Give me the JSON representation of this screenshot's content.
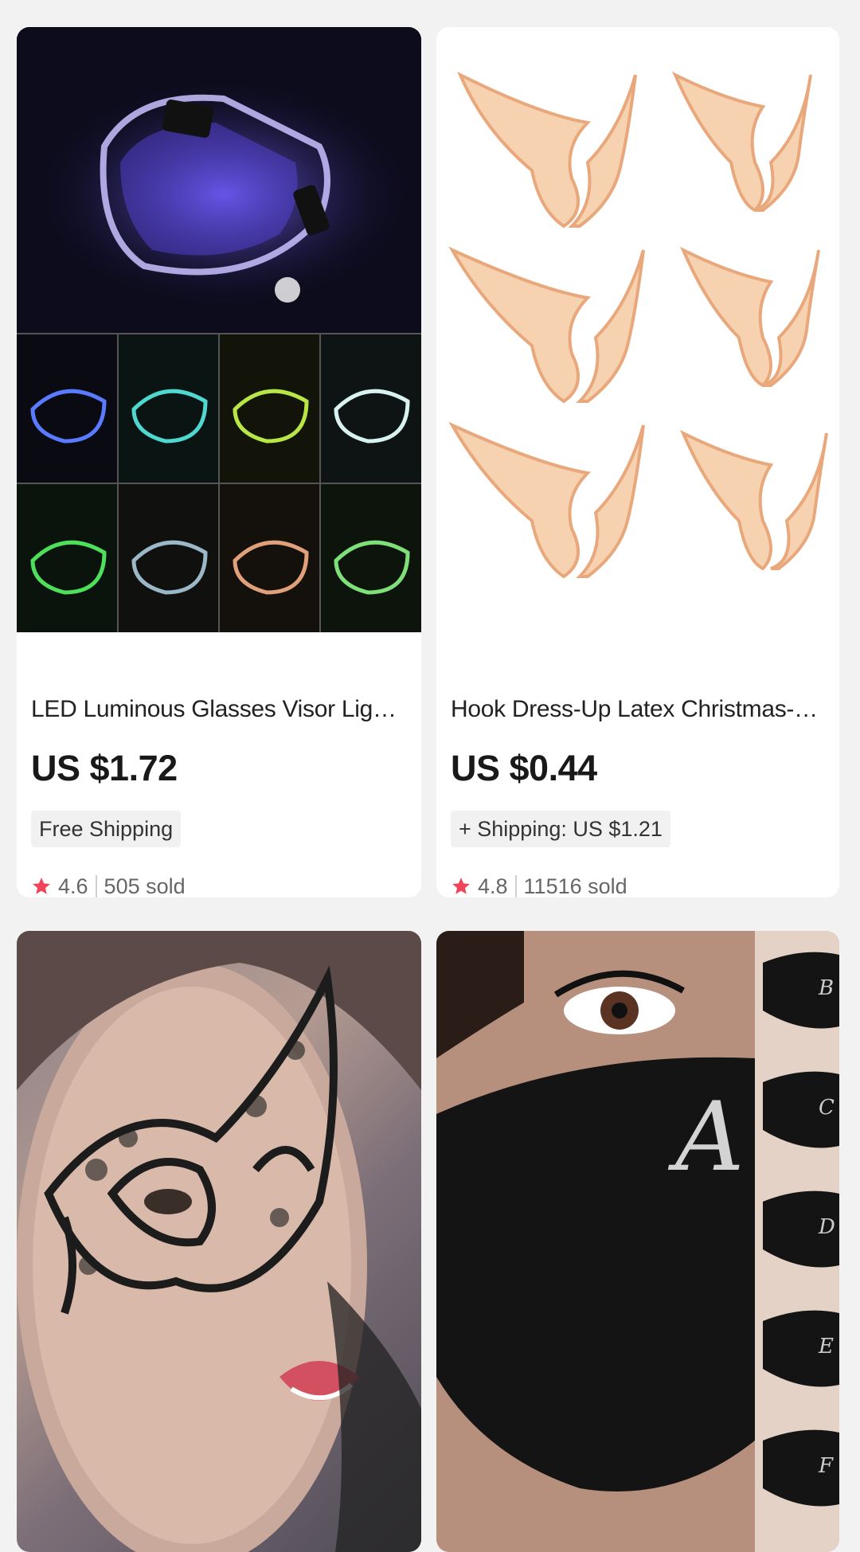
{
  "products": [
    {
      "title": "LED Luminous Glasses Visor Light-Up E...",
      "price": "US $1.72",
      "shipping": "Free Shipping",
      "rating": "4.6",
      "sold": "505 sold",
      "image_icon": "led-visor-glasses-image"
    },
    {
      "title": "Hook Dress-Up Latex Christmas-Decor ...",
      "price": "US $0.44",
      "shipping": "+ Shipping: US $1.21",
      "rating": "4.8",
      "sold": "11516 sold",
      "image_icon": "elf-ears-image"
    },
    {
      "image_icon": "lace-eye-mask-image"
    },
    {
      "image_icon": "rhinestone-face-mask-image",
      "mask_letters": [
        "A",
        "B",
        "C",
        "D",
        "E",
        "F"
      ]
    }
  ],
  "colors": {
    "star": "#f0445a",
    "page_bg": "#f2f2f2",
    "card_bg": "#ffffff"
  }
}
